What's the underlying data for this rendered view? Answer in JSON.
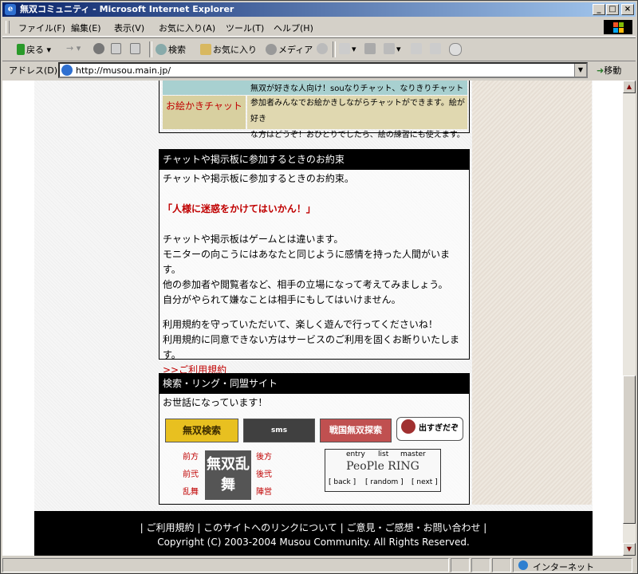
{
  "window": {
    "title": "無双コミュニティ - Microsoft Internet Explorer",
    "minimize": "_",
    "maximize": "□",
    "close": "×"
  },
  "menu": [
    "ファイル(F)",
    "編集(E)",
    "表示(V)",
    "お気に入り(A)",
    "ツール(T)",
    "ヘルプ(H)"
  ],
  "toolbar": {
    "back": "戻る",
    "forward": "→",
    "search": "検索",
    "favorites": "お気に入り",
    "media": "メディア"
  },
  "address": {
    "label": "アドレス(D)",
    "url": "http://musou.main.jp/",
    "go": "移動"
  },
  "chat_table": {
    "row1_desc": "無双が好きな人向け！souなりチャット、なりきりチャットOKです。",
    "row2_name": "お絵かきチャット",
    "row2_desc_1": "参加者みんなでお絵かきしながらチャットができます。絵が好き",
    "row2_desc_2": "な方はどうぞ！おひとりでしたら、絵の練習にも使えます。"
  },
  "rules": {
    "header": "チャットや掲示板に参加するときのお約束",
    "intro": "チャットや掲示板に参加するときのお約束。",
    "slogan": "「人様に迷惑をかけてはいかん！」",
    "p1": "チャットや掲示板はゲームとは違います。",
    "p2": "モニターの向こうにはあなたと同じように感情を持った人間がいます。",
    "p3": "他の参加者や閲覧者など、相手の立場になって考えてみましょう。",
    "p4": "自分がやられて嫌なことは相手にもしてはいけません。",
    "p5": "利用規約を守っていただいて、楽しく遊んで行ってくださいね！",
    "p6": "利用規約に同意できない方はサービスのご利用を固くお断りいたします。",
    "link": ">>ご利用規約"
  },
  "links": {
    "header": "検索・リング・同盟サイト",
    "intro": "お世話になっています！",
    "banner1": "無双検索",
    "banner2": "sms",
    "banner3": "戦国無双探索",
    "banner4": "出すぎだぞ",
    "left_links": [
      "前方",
      "前弐",
      "乱舞"
    ],
    "right_links": [
      "後方",
      "後弐",
      "陣営"
    ],
    "center_logo": "無双乱舞",
    "ring_top": [
      "entry",
      "list",
      "master"
    ],
    "ring_title": "PeoPle RING",
    "ring_bottom": [
      "back",
      "random",
      "next"
    ]
  },
  "footer": {
    "line1": "| ご利用規約 | このサイトへのリンクについて | ご意見・ご感想・お問い合わせ |",
    "line2": "Copyright (C) 2003-2004 Musou Community. All Rights Reserved."
  },
  "status": {
    "zone": "インターネット"
  }
}
